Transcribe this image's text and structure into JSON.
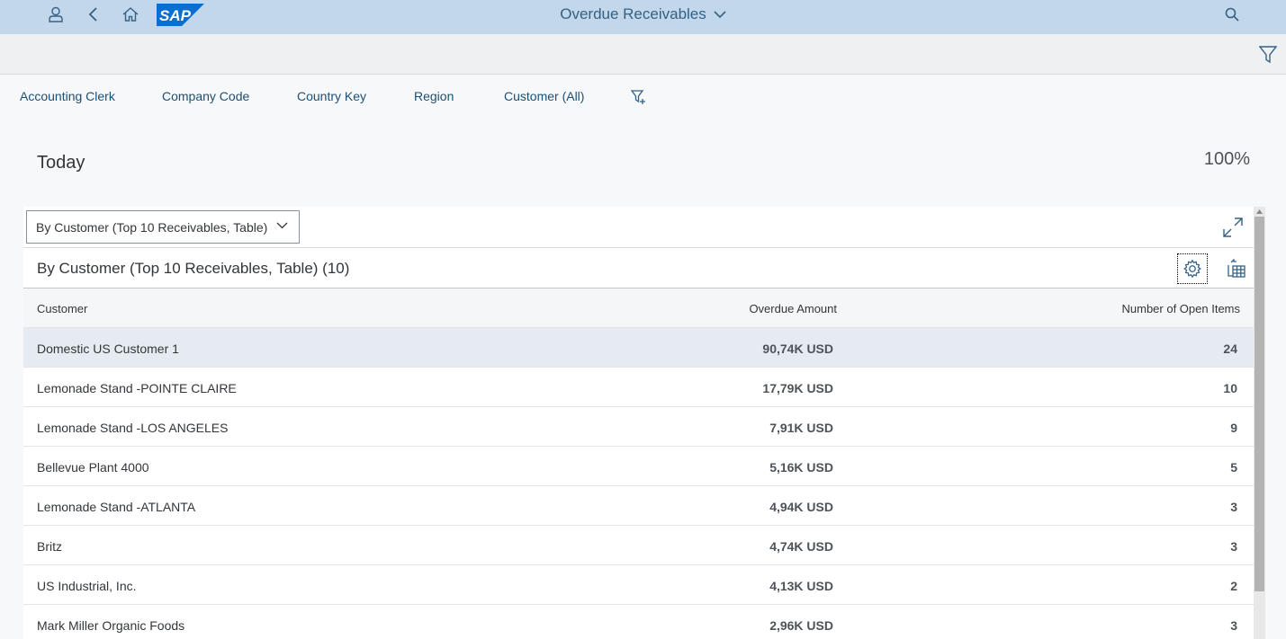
{
  "shell": {
    "app_title": "Overdue Receivables",
    "logo_text": "SAP",
    "colors": {
      "bar": "#c3d7ea",
      "icon": "#346187",
      "logo": "#0a6ed1"
    }
  },
  "filters": {
    "items": [
      "Accounting Clerk",
      "Company Code",
      "Country Key",
      "Region",
      "Customer (All)"
    ]
  },
  "content": {
    "period_label": "Today",
    "percent_label": "100%"
  },
  "card": {
    "view_select_value": "By Customer (Top 10 Receivables, Table)",
    "table_title": "By Customer (Top 10 Receivables, Table) (10)",
    "columns": {
      "customer": "Customer",
      "amount": "Overdue Amount",
      "count": "Number of Open Items"
    },
    "rows": [
      {
        "customer": "Domestic US Customer 1",
        "amount": "90,74K USD",
        "count": "24",
        "selected": true
      },
      {
        "customer": "Lemonade Stand -POINTE CLAIRE",
        "amount": "17,79K USD",
        "count": "10"
      },
      {
        "customer": "Lemonade Stand -LOS ANGELES",
        "amount": "7,91K USD",
        "count": "9"
      },
      {
        "customer": "Bellevue Plant 4000",
        "amount": "5,16K USD",
        "count": "5"
      },
      {
        "customer": "Lemonade Stand -ATLANTA",
        "amount": "4,94K USD",
        "count": "3"
      },
      {
        "customer": "Britz",
        "amount": "4,74K USD",
        "count": "3"
      },
      {
        "customer": "US Industrial, Inc.",
        "amount": "4,13K USD",
        "count": "2"
      },
      {
        "customer": "Mark Miller Organic Foods",
        "amount": "2,96K USD",
        "count": "3"
      }
    ]
  },
  "icons": [
    "user-icon",
    "back-icon",
    "home-icon",
    "search-icon",
    "filter-icon",
    "add-filter-icon",
    "chevron-down-icon",
    "fullscreen-icon",
    "settings-icon",
    "export-icon",
    "scroll-up-icon"
  ]
}
